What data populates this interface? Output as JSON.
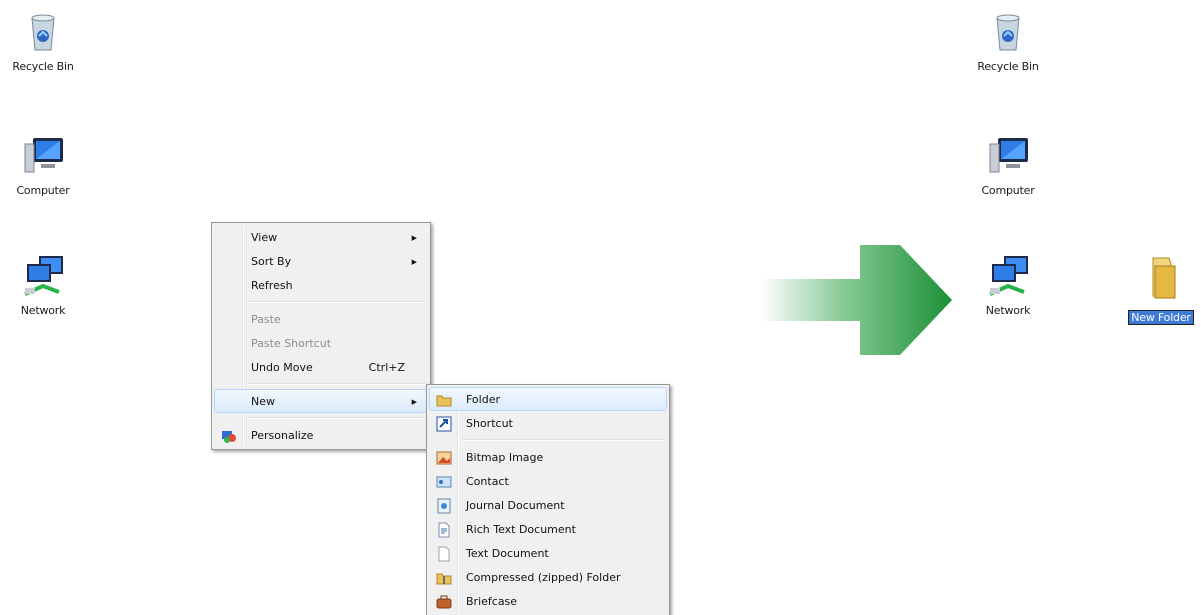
{
  "desktop_left": {
    "icons": [
      {
        "label": "Recycle Bin",
        "icon": "recycle-bin-icon"
      },
      {
        "label": "Computer",
        "icon": "computer-icon"
      },
      {
        "label": "Network",
        "icon": "network-icon"
      }
    ]
  },
  "context_menu": {
    "items": [
      {
        "label": "View",
        "submenu": true
      },
      {
        "label": "Sort By",
        "submenu": true
      },
      {
        "label": "Refresh"
      },
      {
        "label": "Paste",
        "disabled": true
      },
      {
        "label": "Paste Shortcut",
        "disabled": true
      },
      {
        "label": "Undo Move",
        "shortcut": "Ctrl+Z"
      },
      {
        "label": "New",
        "submenu": true,
        "highlighted": true
      },
      {
        "label": "Personalize",
        "icon": "personalize-icon"
      }
    ]
  },
  "new_submenu": {
    "items": [
      {
        "label": "Folder",
        "icon": "folder-icon",
        "highlighted": true
      },
      {
        "label": "Shortcut",
        "icon": "shortcut-icon"
      },
      {
        "label": "Bitmap Image",
        "icon": "bitmap-icon"
      },
      {
        "label": "Contact",
        "icon": "contact-icon"
      },
      {
        "label": "Journal Document",
        "icon": "journal-icon"
      },
      {
        "label": "Rich Text Document",
        "icon": "rich-text-icon"
      },
      {
        "label": "Text Document",
        "icon": "text-document-icon"
      },
      {
        "label": "Compressed (zipped) Folder",
        "icon": "zip-folder-icon"
      },
      {
        "label": "Briefcase",
        "icon": "briefcase-icon"
      }
    ]
  },
  "desktop_right": {
    "icons": [
      {
        "label": "Recycle Bin",
        "icon": "recycle-bin-icon"
      },
      {
        "label": "Computer",
        "icon": "computer-icon"
      },
      {
        "label": "Network",
        "icon": "network-icon"
      }
    ],
    "new_folder": {
      "label": "New Folder",
      "icon": "folder-icon",
      "editing": true
    }
  },
  "colors": {
    "arrow_green": "#1f9a3a",
    "selection_blue": "#3d7bd6",
    "menu_bg": "#f0f0f0"
  }
}
